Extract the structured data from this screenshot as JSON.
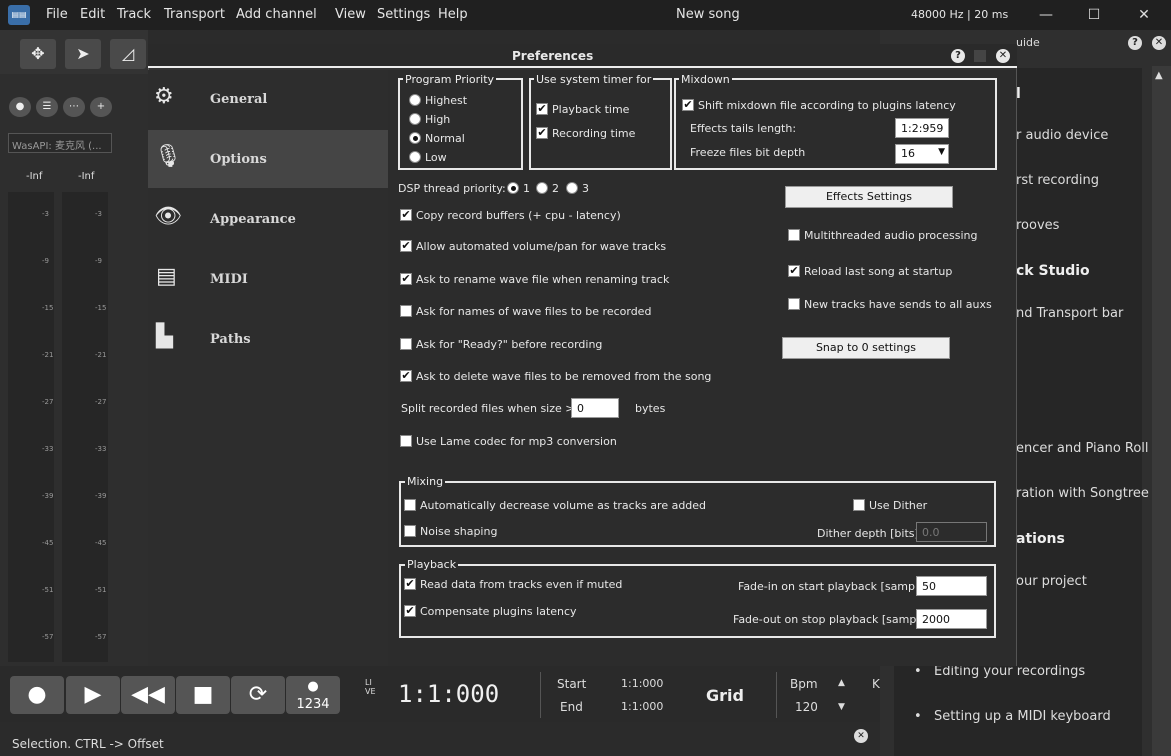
{
  "menu": [
    "File",
    "Edit",
    "Track",
    "Transport",
    "Add channel",
    "View",
    "Settings",
    "Help"
  ],
  "song_title": "New song",
  "audio_info": "48000 Hz | 20 ms",
  "app_icon_label": "▤▤",
  "device_name": "WasAPI: 麦克风 (...",
  "meter": {
    "left": "-Inf",
    "right": "-Inf",
    "ticks": [
      "-3",
      "-9",
      "-15",
      "-21",
      "-27",
      "-33",
      "-39",
      "-45",
      "-51",
      "-57"
    ]
  },
  "preferences": {
    "title": "Preferences",
    "nav": [
      "General",
      "Options",
      "Appearance",
      "MIDI",
      "Paths"
    ],
    "program_priority": {
      "title": "Program Priority",
      "options": [
        "Highest",
        "High",
        "Normal",
        "Low"
      ],
      "selected": "Normal"
    },
    "system_timer": {
      "title": "Use system timer for",
      "playback": "Playback time",
      "recording": "Recording time"
    },
    "mixdown": {
      "title": "Mixdown",
      "shift": "Shift mixdown file according to plugins latency",
      "tails_label": "Effects tails length:",
      "tails_value": "1:2:959",
      "freeze_label": "Freeze files bit depth",
      "freeze_value": "16"
    },
    "dsp": {
      "label": "DSP thread priority:",
      "options": [
        "1",
        "2",
        "3"
      ],
      "selected": "1"
    },
    "options": [
      {
        "label": "Copy record buffers (+ cpu - latency)",
        "checked": true
      },
      {
        "label": "Allow automated volume/pan for wave tracks",
        "checked": true
      },
      {
        "label": "Ask to rename wave file when renaming track",
        "checked": true
      },
      {
        "label": "Ask for names of wave files to be recorded",
        "checked": false
      },
      {
        "label": "Ask for \"Ready?\" before recording",
        "checked": false
      },
      {
        "label": "Ask to delete wave files to be removed from the song",
        "checked": true
      }
    ],
    "split": {
      "label": "Split recorded files when size >",
      "value": "0",
      "unit": "bytes"
    },
    "lame": "Use Lame codec for mp3 conversion",
    "effects_button": "Effects Settings",
    "multithreaded": "Multithreaded audio processing",
    "reload": "Reload last song at startup",
    "new_tracks": "New tracks have sends to all auxs",
    "snap_button": "Snap to 0 settings",
    "mixing": {
      "title": "Mixing",
      "auto_decrease": "Automatically decrease volume as tracks are added",
      "use_dither": "Use Dither",
      "noise": "Noise shaping",
      "dither_depth": "Dither depth [bits]",
      "dither_value": "0.0"
    },
    "playback": {
      "title": "Playback",
      "read_muted": "Read data from tracks even if muted",
      "compensate": "Compensate plugins latency",
      "fadein_label": "Fade-in on start playback [samples]",
      "fadein_value": "50",
      "fadeout_label": "Fade-out on stop playback [samples]",
      "fadeout_value": "2000"
    }
  },
  "right_panel": {
    "title_fragment": "uide",
    "items": [
      {
        "text": "l",
        "bold": true
      },
      {
        "text": "r audio device",
        "bold": false
      },
      {
        "text": "rst recording",
        "bold": false
      },
      {
        "text": "rooves",
        "bold": false
      },
      {
        "text": "ck Studio",
        "bold": true
      },
      {
        "text": "nd Transport bar",
        "bold": false
      },
      {
        "text": "encer and Piano Roll",
        "bold": false
      },
      {
        "text": "ration with Songtree",
        "bold": false
      },
      {
        "text": "ations",
        "bold": true
      },
      {
        "text": "our project",
        "bold": false
      },
      {
        "text": "Editing your recordings",
        "bold": false
      },
      {
        "text": "Setting up a MIDI keyboard",
        "bold": false
      }
    ]
  },
  "transport": {
    "live": "LIVE",
    "time": "1:1:000",
    "start_label": "Start",
    "start_value": "1:1:000",
    "end_label": "End",
    "end_value": "1:1:000",
    "grid": "Grid",
    "bpm_label": "Bpm",
    "bpm_value": "120",
    "count_label": "1234",
    "k_label": "K"
  },
  "status": "Selection. CTRL -> Offset"
}
